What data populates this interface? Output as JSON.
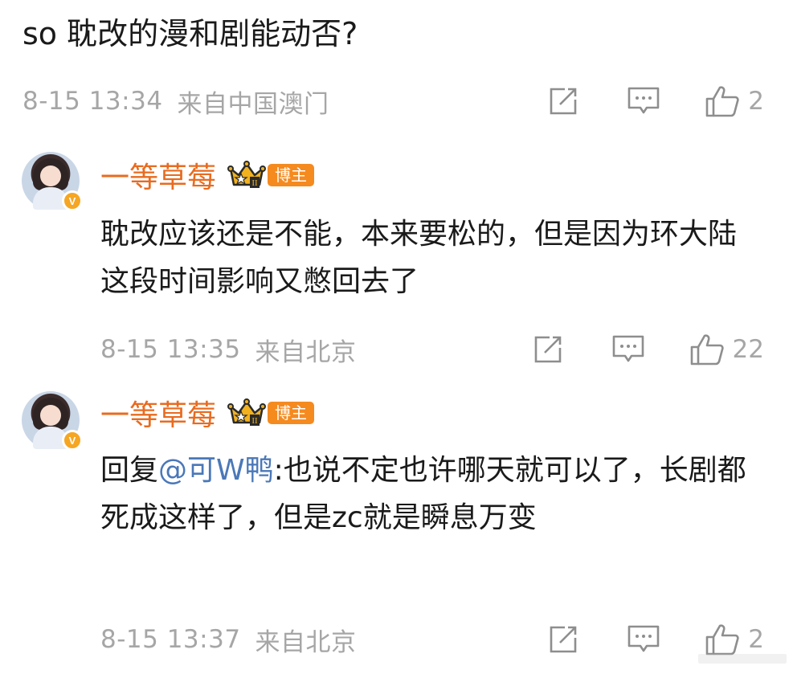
{
  "top_comment": {
    "text": "so 耽改的漫和剧能动否?",
    "timestamp": "8-15 13:34",
    "source": "来自中国澳门",
    "like_count": "2"
  },
  "replies": [
    {
      "username": "一等草莓",
      "badge_label": "博主",
      "crown_level": "II",
      "verified_mark": "V",
      "text": "耽改应该还是不能，本来要松的，但是因为环大陆这段时间影响又憋回去了",
      "timestamp": "8-15 13:35",
      "source": "来自北京",
      "like_count": "22"
    },
    {
      "username": "一等草莓",
      "badge_label": "博主",
      "crown_level": "II",
      "verified_mark": "V",
      "reply_prefix": "回复",
      "mention": "@可W鸭",
      "text": ":也说不定也许哪天就可以了，长剧都死成这样了，但是zc就是瞬息万变",
      "timestamp": "8-15 13:37",
      "source": "来自北京",
      "like_count": "2"
    }
  ],
  "icons": {
    "share": "share-icon",
    "comment": "comment-icon",
    "like": "thumbs-up-icon"
  },
  "colors": {
    "username": "#e86b1f",
    "badge": "#f58a1f",
    "mention": "#4a78b8",
    "meta": "#a6a6a6",
    "verified": "#f5a623"
  }
}
